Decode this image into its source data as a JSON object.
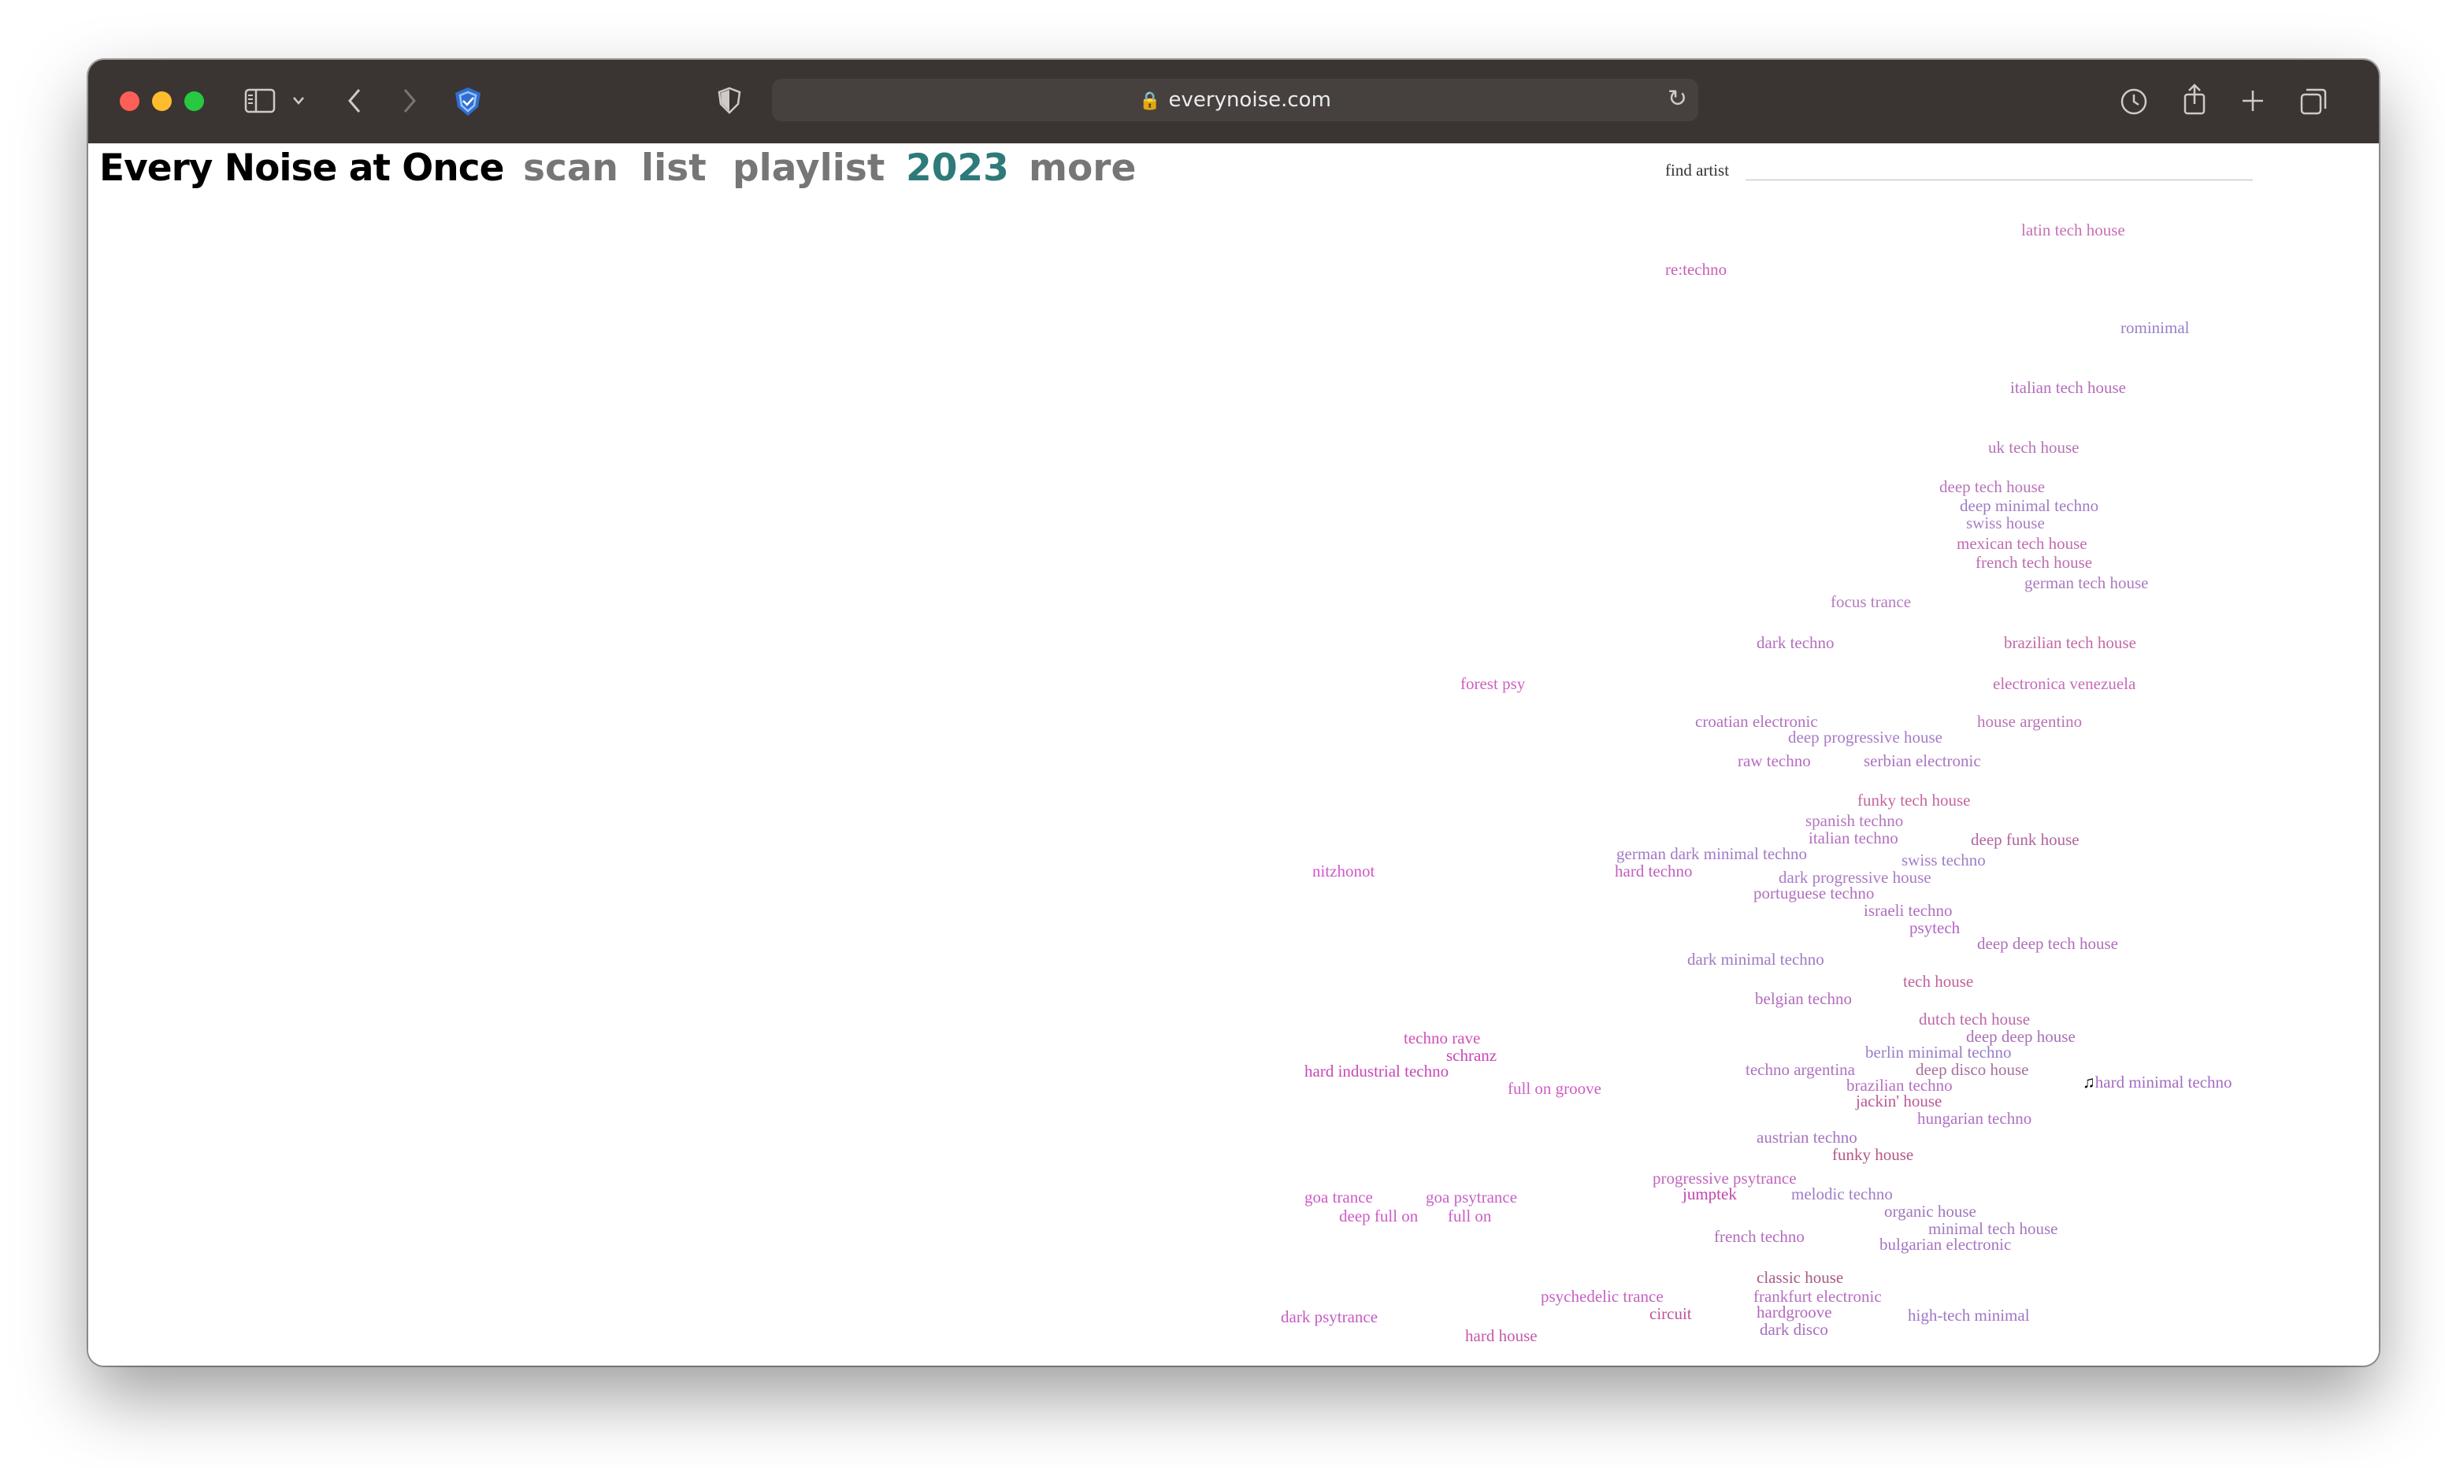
{
  "browser": {
    "url": "everynoise.com",
    "icons": {
      "sidebar": "sidebar-icon",
      "back": "chevron-left-icon",
      "forward": "chevron-right-icon",
      "shield": "shield-icon",
      "privacy": "privacy-report-icon",
      "history": "history-icon",
      "share": "share-icon",
      "new_tab": "plus-icon",
      "tabs": "tab-overview-icon"
    }
  },
  "header": {
    "logo": "Every Noise at Once",
    "nav": [
      {
        "label": "scan",
        "active": false
      },
      {
        "label": "list",
        "active": false
      },
      {
        "label": "playlist",
        "active": false
      },
      {
        "label": "2023",
        "active": true
      },
      {
        "label": "more",
        "active": false
      }
    ],
    "find_artist_label": "find artist",
    "find_artist_value": ""
  },
  "colors": {
    "nav_active": "#2e7a7a",
    "nav_inactive": "#767676"
  },
  "genres": [
    {
      "label": "latin tech house",
      "color": "#c86fb3"
    },
    {
      "label": "re:techno",
      "color": "#c860b8"
    },
    {
      "label": "rominimal",
      "color": "#9a7fc8"
    },
    {
      "label": "italian tech house",
      "color": "#b56cbb"
    },
    {
      "label": "uk tech house",
      "color": "#b673b5"
    },
    {
      "label": "deep tech house",
      "color": "#b875b9"
    },
    {
      "label": "deep minimal techno",
      "color": "#a07cc2"
    },
    {
      "label": "swiss house",
      "color": "#a97ec4"
    },
    {
      "label": "mexican tech house",
      "color": "#c26cb0"
    },
    {
      "label": "french tech house",
      "color": "#bd6cae"
    },
    {
      "label": "german tech house",
      "color": "#a97bbf"
    },
    {
      "label": "focus trance",
      "color": "#b57bbf"
    },
    {
      "label": "dark techno",
      "color": "#b36ebb"
    },
    {
      "label": "brazilian tech house",
      "color": "#c16aa5"
    },
    {
      "label": "forest psy",
      "color": "#d060c0"
    },
    {
      "label": "electronica venezuela",
      "color": "#c46cb8"
    },
    {
      "label": "croatian electronic",
      "color": "#b370c2"
    },
    {
      "label": "house argentino",
      "color": "#b875b5"
    },
    {
      "label": "deep progressive house",
      "color": "#a87bc7"
    },
    {
      "label": "raw techno",
      "color": "#b86dbf"
    },
    {
      "label": "serbian electronic",
      "color": "#aa74c0"
    },
    {
      "label": "funky tech house",
      "color": "#c4669e"
    },
    {
      "label": "spanish techno",
      "color": "#b674c0"
    },
    {
      "label": "italian techno",
      "color": "#b46fbf"
    },
    {
      "label": "deep funk house",
      "color": "#b0659e"
    },
    {
      "label": "german dark minimal techno",
      "color": "#a27ac5"
    },
    {
      "label": "swiss techno",
      "color": "#a07dc5"
    },
    {
      "label": "hard techno",
      "color": "#c060c0"
    },
    {
      "label": "dark progressive house",
      "color": "#a87cc6"
    },
    {
      "label": "nitzhonot",
      "color": "#d058c8"
    },
    {
      "label": "portuguese techno",
      "color": "#b46ec0"
    },
    {
      "label": "israeli techno",
      "color": "#b06fc2"
    },
    {
      "label": "psytech",
      "color": "#b265c8"
    },
    {
      "label": "deep deep tech house",
      "color": "#b06fbb"
    },
    {
      "label": "dark minimal techno",
      "color": "#9f7bc4"
    },
    {
      "label": "tech house",
      "color": "#c0609a"
    },
    {
      "label": "belgian techno",
      "color": "#b36cbc"
    },
    {
      "label": "dutch tech house",
      "color": "#bb68a8"
    },
    {
      "label": "techno rave",
      "color": "#d050b8"
    },
    {
      "label": "deep deep house",
      "color": "#a870b5"
    },
    {
      "label": "schranz",
      "color": "#c645b8"
    },
    {
      "label": "berlin minimal techno",
      "color": "#9a7cc6"
    },
    {
      "label": "hard industrial techno",
      "color": "#c848b6"
    },
    {
      "label": "techno argentina",
      "color": "#ae72c2"
    },
    {
      "label": "deep disco house",
      "color": "#a7709d"
    },
    {
      "label": "hard minimal techno",
      "color": "#a46cc2"
    },
    {
      "label": "full on groove",
      "color": "#d05cc4"
    },
    {
      "label": "brazilian techno",
      "color": "#b56ec2"
    },
    {
      "label": "jackin' house",
      "color": "#bb5a92"
    },
    {
      "label": "hungarian techno",
      "color": "#b06fc4"
    },
    {
      "label": "austrian techno",
      "color": "#a673c0"
    },
    {
      "label": "funky house",
      "color": "#b45885"
    },
    {
      "label": "progressive psytrance",
      "color": "#c167bd"
    },
    {
      "label": "jumptek",
      "color": "#bf44ab"
    },
    {
      "label": "melodic techno",
      "color": "#a07cc6"
    },
    {
      "label": "goa trance",
      "color": "#cf5cc7"
    },
    {
      "label": "goa psytrance",
      "color": "#c862c6"
    },
    {
      "label": "organic house",
      "color": "#a177be"
    },
    {
      "label": "deep full on",
      "color": "#d05ac6"
    },
    {
      "label": "full on",
      "color": "#cb5dc5"
    },
    {
      "label": "minimal tech house",
      "color": "#a477be"
    },
    {
      "label": "french techno",
      "color": "#b36cbe"
    },
    {
      "label": "bulgarian electronic",
      "color": "#a674c0"
    },
    {
      "label": "classic house",
      "color": "#a55d82"
    },
    {
      "label": "frankfurt electronic",
      "color": "#b66ec2"
    },
    {
      "label": "psychedelic trance",
      "color": "#c560c3"
    },
    {
      "label": "hardgroove",
      "color": "#b368bd"
    },
    {
      "label": "circuit",
      "color": "#b9569e"
    },
    {
      "label": "high-tech minimal",
      "color": "#a176c4"
    },
    {
      "label": "dark psytrance",
      "color": "#c65bc3"
    },
    {
      "label": "dark disco",
      "color": "#a66ebd"
    },
    {
      "label": "hard house",
      "color": "#c25bab"
    }
  ],
  "playing_genre": "hard minimal techno",
  "playing_icon": "music-note-icon"
}
